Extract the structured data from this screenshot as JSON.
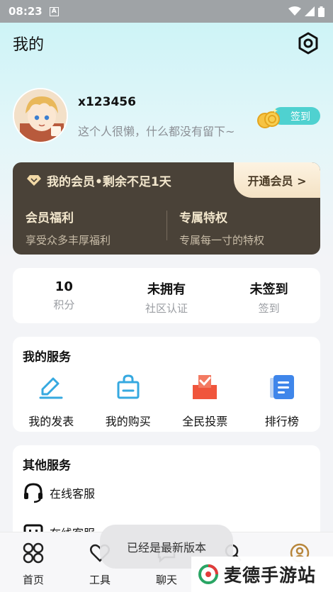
{
  "status_bar": {
    "time": "08:23",
    "app_badge": "A"
  },
  "header": {
    "title": "我的",
    "settings_icon": "gear-icon"
  },
  "profile": {
    "username": "x123456",
    "bio": "这个人很懒，什么都没有留下~",
    "checkin_label": "签到"
  },
  "vip": {
    "status": "我的会员•剩余不足1天",
    "open_button": "开通会员 >",
    "benefits": [
      {
        "title": "会员福利",
        "subtitle": "享受众多丰厚福利"
      },
      {
        "title": "专属特权",
        "subtitle": "专属每一寸的特权"
      }
    ]
  },
  "stats": [
    {
      "value": "10",
      "label": "积分"
    },
    {
      "value": "未拥有",
      "label": "社区认证"
    },
    {
      "value": "未签到",
      "label": "签到"
    }
  ],
  "my_services": {
    "title": "我的服务",
    "items": [
      {
        "label": "我的发表",
        "icon": "pencil-icon"
      },
      {
        "label": "我的购买",
        "icon": "shopping-bag-icon"
      },
      {
        "label": "全民投票",
        "icon": "vote-box-icon"
      },
      {
        "label": "排行榜",
        "icon": "ranking-doc-icon"
      }
    ]
  },
  "other_services": {
    "title": "其他服务",
    "items": [
      {
        "label": "在线客服",
        "icon": "headset-icon"
      },
      {
        "label": "在线客服",
        "icon": "message-icon"
      }
    ]
  },
  "toast": "已经是最新版本",
  "bottom_nav": [
    {
      "label": "首页",
      "icon": "home-grid-icon"
    },
    {
      "label": "工具",
      "icon": "heart-icon"
    },
    {
      "label": "聊天",
      "icon": "chat-icon"
    },
    {
      "label": "",
      "icon": "community-icon"
    },
    {
      "label": "",
      "icon": "user-icon"
    }
  ],
  "watermark": "麦德手游站",
  "colors": {
    "accent": "#4fd1d0",
    "vip_bg": "#4a4238",
    "vip_text": "#f2e6cc"
  }
}
